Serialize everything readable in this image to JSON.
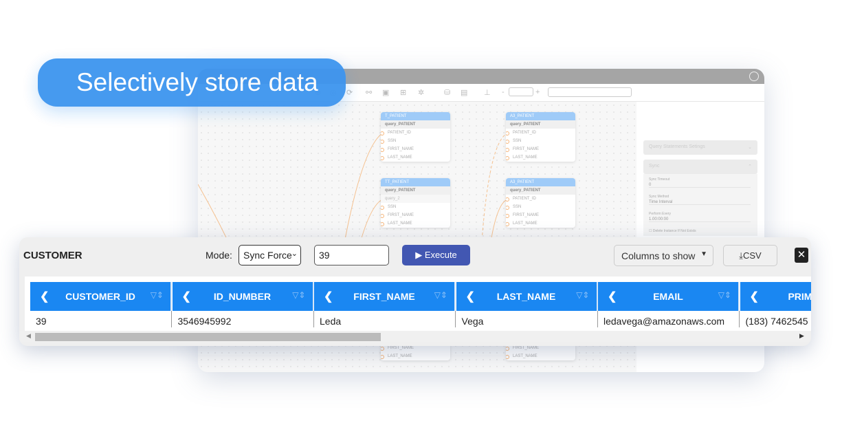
{
  "banner": {
    "text": "Selectively store data",
    "color": "#3d95ef"
  },
  "toolbar": {
    "minus": "-",
    "plus": "+"
  },
  "nodes": [
    {
      "title": "T_PATIENT",
      "query": "query_PATIENT",
      "fields": [
        "PATIENT_ID",
        "SSN",
        "FIRST_NAME",
        "LAST_NAME"
      ]
    },
    {
      "title": "A3_PATIENT",
      "query": "query_PATIENT",
      "fields": [
        "PATIENT_ID",
        "SSN",
        "FIRST_NAME",
        "LAST_NAME"
      ]
    },
    {
      "title": "TT_PATIENT",
      "query": "query_PATIENT",
      "query2": "query_2",
      "fields": [
        "SSN",
        "FIRST_NAME",
        "LAST_NAME"
      ]
    },
    {
      "title": "A3_PATIENT",
      "query": "query_PATIENT",
      "fields": [
        "PATIENT_ID",
        "SSN",
        "FIRST_NAME",
        "LAST_NAME"
      ]
    }
  ],
  "hidden_nodes_fields": [
    "FIRST_NAME",
    "LAST_NAME"
  ],
  "panel": {
    "query_settings": "Query Statements Setings",
    "sync": "Sync",
    "sync_timeout_label": "Sync Timeout",
    "sync_timeout": "0",
    "sync_method_label": "Sync Method",
    "sync_method": "Time Interval",
    "perform_every_label": "Perform Every",
    "perform_every": "1.00:00:00",
    "delete_label": "Delete Instance If Not Exists"
  },
  "dialog": {
    "title": "CUSTOMER",
    "mode_label": "Mode:",
    "mode": "Sync Force",
    "input": "39",
    "execute": "Execute",
    "columns": "Columns to show",
    "csv": "CSV",
    "accent": "#1a87f2",
    "button_color": "#4257b2"
  },
  "table": {
    "columns": [
      "CUSTOMER_ID",
      "ID_NUMBER",
      "FIRST_NAME",
      "LAST_NAME",
      "EMAIL",
      "PRIMARY"
    ],
    "row": [
      "39",
      "3546945992",
      "Leda",
      "Vega",
      "ledavega@amazonaws.com",
      "(183) 7462545"
    ]
  }
}
